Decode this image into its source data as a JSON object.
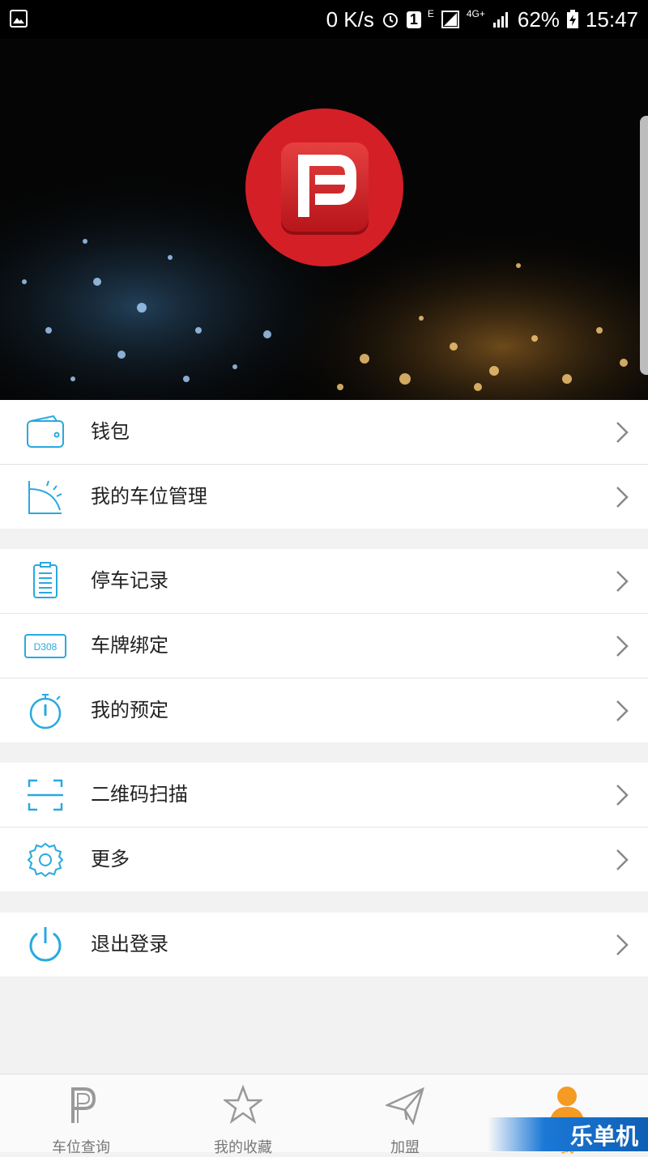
{
  "status_bar": {
    "speed": "0 K/s",
    "sim_badge": "1",
    "network_e": "E",
    "network_4g": "4G+",
    "battery": "62%",
    "time": "15:47"
  },
  "header": {
    "logo_icon": "parking-p-logo",
    "accent": "#d51f26"
  },
  "menu": {
    "group1": [
      {
        "label": "钱包",
        "icon": "wallet-icon"
      },
      {
        "label": "我的车位管理",
        "icon": "parking-space-icon"
      }
    ],
    "group2": [
      {
        "label": "停车记录",
        "icon": "clipboard-icon"
      },
      {
        "label": "车牌绑定",
        "icon": "license-plate-icon",
        "plate_text": "D308"
      },
      {
        "label": "我的预定",
        "icon": "stopwatch-icon"
      }
    ],
    "group3": [
      {
        "label": "二维码扫描",
        "icon": "scan-icon"
      },
      {
        "label": "更多",
        "icon": "gear-icon"
      }
    ],
    "group4": [
      {
        "label": "退出登录",
        "icon": "power-icon"
      }
    ]
  },
  "bottom_nav": [
    {
      "label": "车位查询",
      "icon": "parking-p-icon"
    },
    {
      "label": "我的收藏",
      "icon": "star-icon"
    },
    {
      "label": "加盟",
      "icon": "paper-plane-icon"
    },
    {
      "label": "我",
      "icon": "user-icon",
      "active": true
    }
  ],
  "watermark": {
    "text": "乐单机"
  },
  "colors": {
    "icon_blue": "#29a9e0",
    "active_orange": "#f59a23"
  }
}
